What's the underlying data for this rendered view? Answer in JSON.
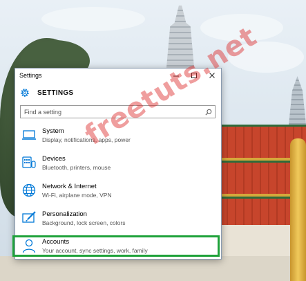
{
  "window": {
    "title": "Settings",
    "controls": {
      "minimize": "—",
      "maximize": "☐",
      "close": "✕"
    }
  },
  "header": {
    "title": "SETTINGS",
    "icon": "gear-icon"
  },
  "search": {
    "placeholder": "Find a setting",
    "icon": "search-icon"
  },
  "categories": [
    {
      "name": "System",
      "description": "Display, notifications, apps, power",
      "icon": "laptop-icon"
    },
    {
      "name": "Devices",
      "description": "Bluetooth, printers, mouse",
      "icon": "keyboard-icon"
    },
    {
      "name": "Network & Internet",
      "description": "Wi-Fi, airplane mode, VPN",
      "icon": "globe-icon"
    },
    {
      "name": "Personalization",
      "description": "Background, lock screen, colors",
      "icon": "paint-icon"
    },
    {
      "name": "Accounts",
      "description": "Your account, sync settings, work, family",
      "icon": "person-icon"
    }
  ],
  "selected_category": "Accounts",
  "colors": {
    "accent": "#0078d7",
    "highlight": "#1fa23a",
    "watermark": "#dc2828"
  },
  "watermark": "freetuts.net"
}
